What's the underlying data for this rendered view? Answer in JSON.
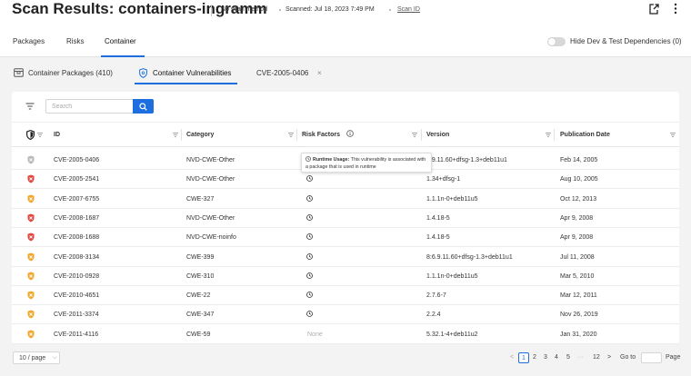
{
  "header": {
    "title": "Scan Results: containers-ingramm",
    "scan_method": "No scan method",
    "scanned": "Scanned:  Jul 18, 2023 7:49 PM",
    "scan_id": "Scan ID"
  },
  "top_tabs": [
    "Packages",
    "Risks",
    "Container"
  ],
  "toggle_label": "Hide Dev & Test Dependencies (0)",
  "sub_tabs": {
    "packages": "Container Packages (410)",
    "vulnerabilities": "Container Vulnerabilities",
    "cve": "CVE-2005-0406",
    "close": "×"
  },
  "search": {
    "placeholder": "Search"
  },
  "columns": {
    "id": "ID",
    "category": "Category",
    "risk_factors": "Risk Factors",
    "version": "Version",
    "publication_date": "Publication Date"
  },
  "tooltip": {
    "title": "Runtime Usage:",
    "text": " This vulnerability is associated with a package that is used in runtime"
  },
  "rows": [
    {
      "severity": "low",
      "id": "CVE-2005-0406",
      "category": "NVD-CWE-Other",
      "risk": "",
      "version": "8.9.11.60+dfsg-1.3+deb11u1",
      "date": "Feb 14, 2005"
    },
    {
      "severity": "high",
      "id": "CVE-2005-2541",
      "category": "NVD-CWE-Other",
      "risk": "",
      "version": "1.34+dfsg-1",
      "date": "Aug 10, 2005"
    },
    {
      "severity": "medium",
      "id": "CVE-2007-6755",
      "category": "CWE-327",
      "risk": "",
      "version": "1.1.1n-0+deb11u5",
      "date": "Oct 12, 2013"
    },
    {
      "severity": "high",
      "id": "CVE-2008-1687",
      "category": "NVD-CWE-Other",
      "risk": "",
      "version": "1.4.18-5",
      "date": "Apr 9, 2008"
    },
    {
      "severity": "high",
      "id": "CVE-2008-1688",
      "category": "NVD-CWE-noinfo",
      "risk": "",
      "version": "1.4.18-5",
      "date": "Apr 9, 2008"
    },
    {
      "severity": "medium",
      "id": "CVE-2008-3134",
      "category": "CWE-399",
      "risk": "",
      "version": "8:6.9.11.60+dfsg-1.3+deb11u1",
      "date": "Jul 11, 2008"
    },
    {
      "severity": "medium",
      "id": "CVE-2010-0928",
      "category": "CWE-310",
      "risk": "",
      "version": "1.1.1n-0+deb11u5",
      "date": "Mar 5, 2010"
    },
    {
      "severity": "medium",
      "id": "CVE-2010-4651",
      "category": "CWE-22",
      "risk": "",
      "version": "2.7.6-7",
      "date": "Mar 12, 2011"
    },
    {
      "severity": "medium",
      "id": "CVE-2011-3374",
      "category": "CWE-347",
      "risk": "",
      "version": "2.2.4",
      "date": "Nov 26, 2019"
    },
    {
      "severity": "medium",
      "id": "CVE-2011-4116",
      "category": "CWE-59",
      "risk": "None",
      "version": "5.32.1-4+deb11u2",
      "date": "Jan 31, 2020"
    }
  ],
  "pagination": {
    "page_size": "10 / page",
    "prev": "<",
    "pages": [
      "1",
      "2",
      "3",
      "4",
      "5"
    ],
    "ellipsis": "···",
    "last": "12",
    "next": ">",
    "goto_label": "Go to",
    "page_label": "Page"
  },
  "colors": {
    "accent": "#1d6fe0",
    "high": "#e2463f",
    "medium": "#f0a72c",
    "low": "#b8b8b8"
  }
}
